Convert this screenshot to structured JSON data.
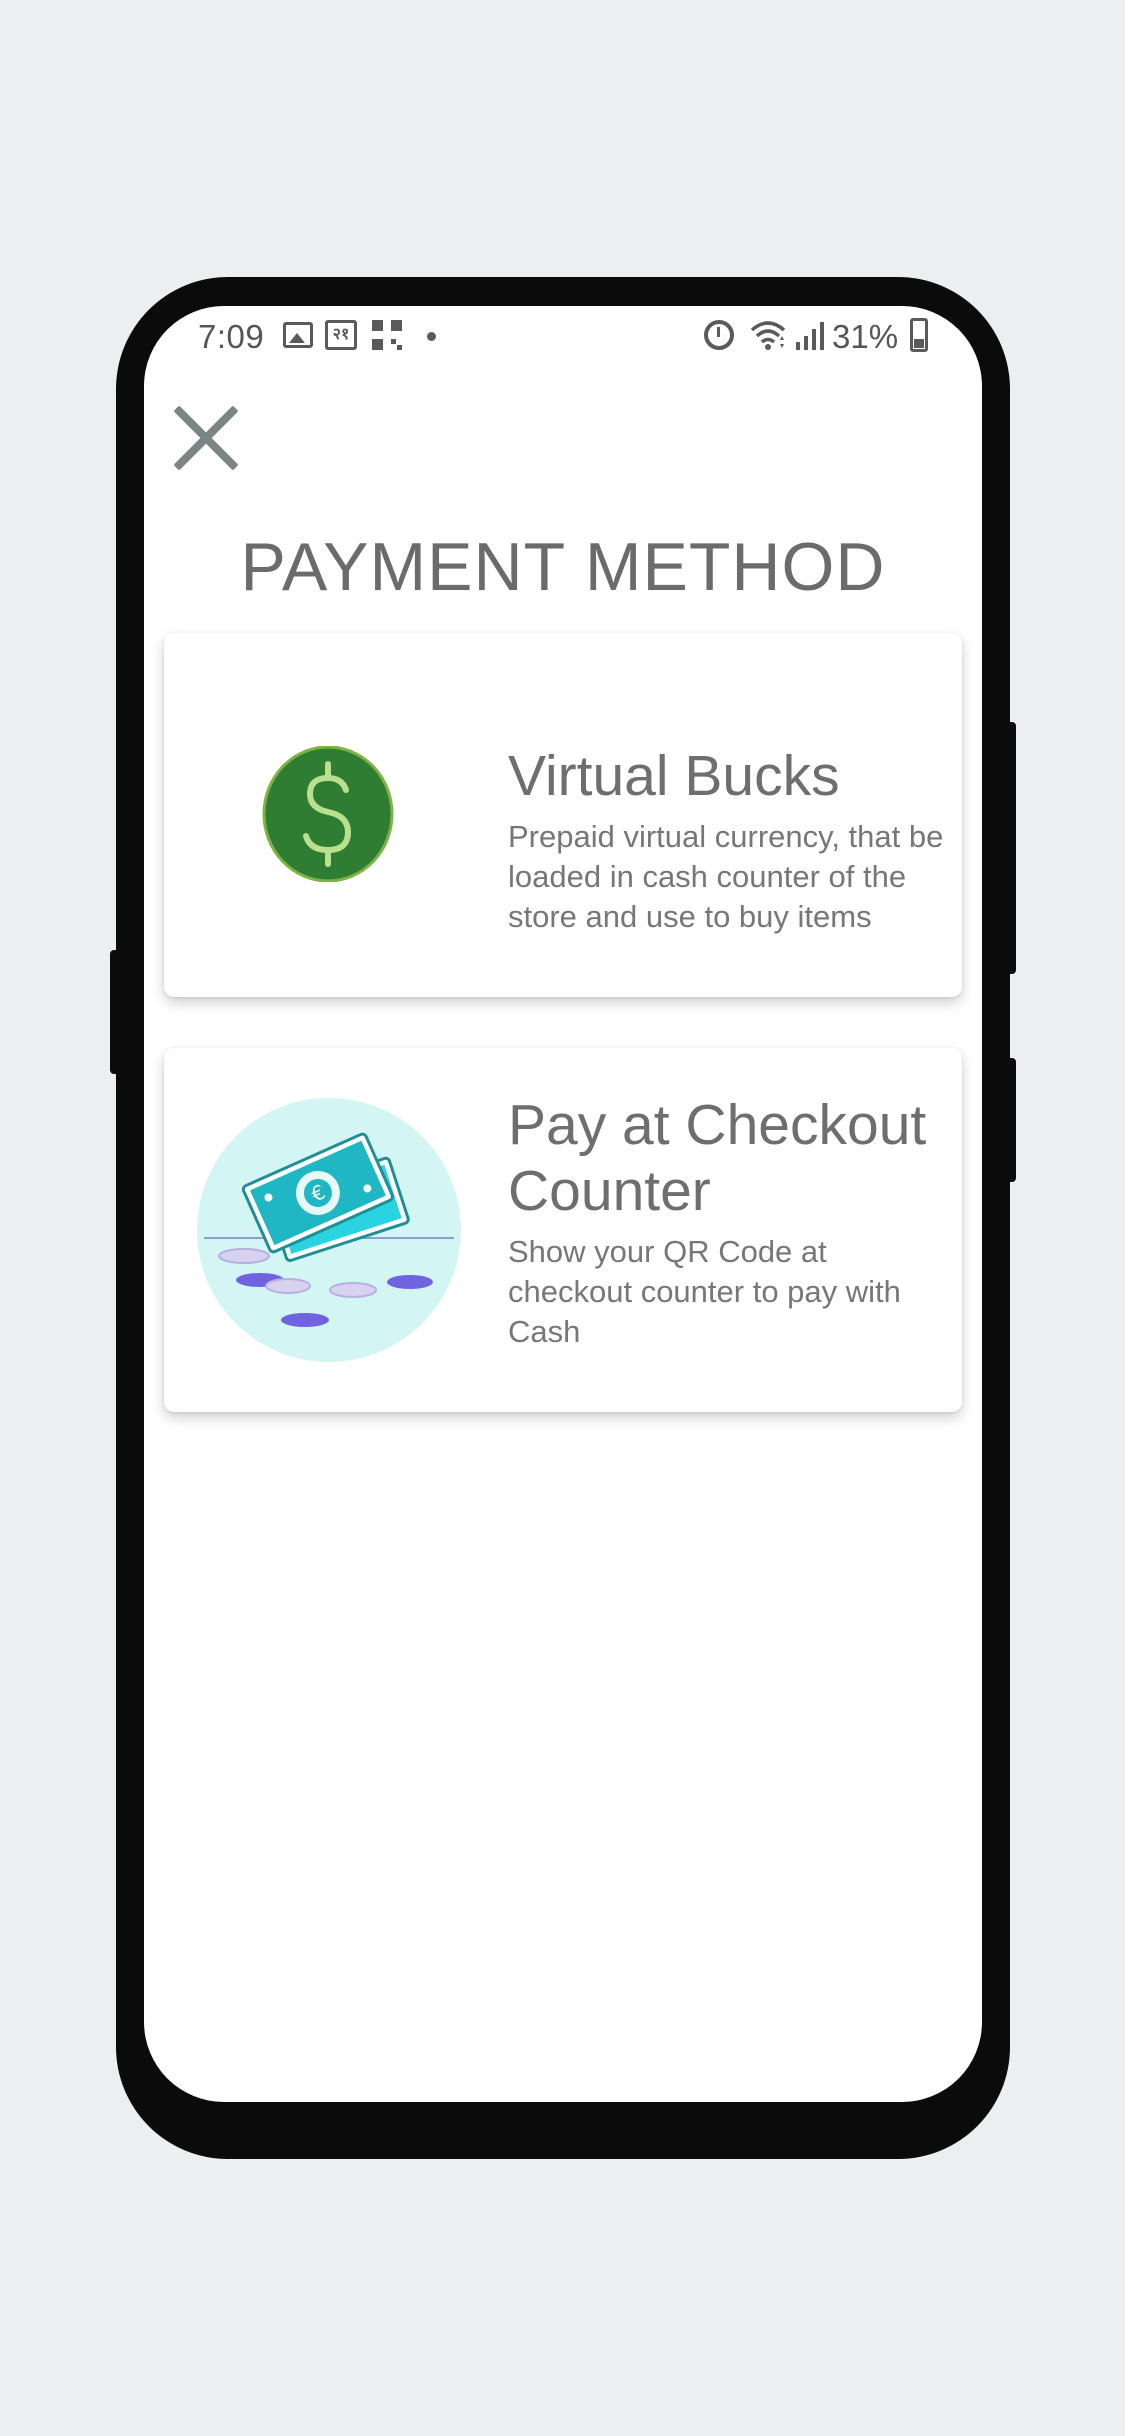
{
  "status_bar": {
    "time": "7:09",
    "rupee_icon_text": "२१",
    "battery": "31%"
  },
  "header": {
    "title": "PAYMENT METHOD"
  },
  "payment_options": [
    {
      "title": "Virtual Bucks",
      "description": "Prepaid virtual currency, that be loaded in cash counter of the store and use to buy items",
      "icon": "dollar-coin-icon",
      "icon_color": "#2e7d32"
    },
    {
      "title": "Pay at Checkout Counter",
      "description": "Show your QR Code at checkout counter to pay with Cash",
      "icon": "cash-stack-illustration",
      "icon_color": "#26c6da"
    }
  ]
}
